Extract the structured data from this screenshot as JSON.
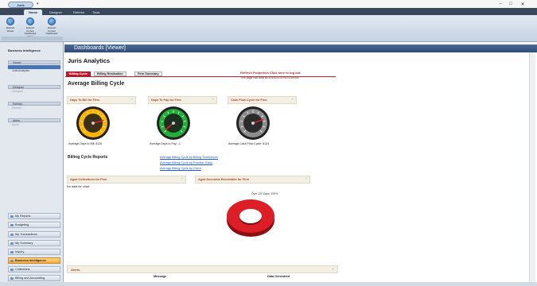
{
  "titlebar": {
    "orb_label": "Juris",
    "window_controls": [
      "–",
      "□",
      "✕"
    ]
  },
  "ribbon": {
    "tabs": [
      "Home",
      "Designer",
      "Refresh",
      "Tools"
    ],
    "buttons": [
      {
        "label": "Refresh Viewer",
        "icon": "refresh-icon"
      },
      {
        "label": "Refresh Current Dashboard Page",
        "icon": "refresh-icon"
      },
      {
        "label": "Refresh Current Dashboard",
        "icon": "refresh-icon"
      }
    ]
  },
  "sidebar": {
    "header": "Business Intelligence",
    "sections": [
      {
        "label": "Viewer",
        "sub": "Juris Analytics",
        "selected": true
      },
      {
        "label": "Designer",
        "sub": "Designer"
      },
      {
        "label": "Refresh",
        "sub": "Refresh"
      },
      {
        "label": "Alerts",
        "sub": "Alerts"
      }
    ],
    "nav": [
      "My Reports",
      "Budgeting",
      "My Transactions",
      "My Summary",
      "Inquiry",
      "Business Intelligence",
      "Collections",
      "Billing and Accounting"
    ],
    "active_nav": "Business Intelligence"
  },
  "content": {
    "header": "Dashboards [Viewer]",
    "page_title": "Juris Analytics",
    "tabs": [
      "Billing Cycle",
      "Billing Realization",
      "Firm Summary"
    ],
    "links": "Refresh  Properties  Click here to log out.",
    "refresh_note": "This page has data as of 8/5/2018 08:03:58 AM",
    "section_title": "Average Billing Cycle",
    "gauges": [
      {
        "title": "Days To Bill for Firm",
        "caption": "Average Days to Bill: 8126",
        "value": 0.78,
        "face": "#ffb400"
      },
      {
        "title": "Days To Pay for Firm",
        "caption": "Average Days to Pay: -1",
        "value": 0.02,
        "face": "#22b03a"
      },
      {
        "title": "Cash Flow Cycle for Firm",
        "caption": "Average Cash Flow Cycle: 8124",
        "value": 0.76,
        "face": "#8d8d8d"
      }
    ],
    "reports_title": "Billing Cycle Reports",
    "report_links": [
      "Average Billing Cycle by Billing Timekeeper",
      "Average Billing Cycle by Practice Class",
      "Average Billing Cycle by Client"
    ],
    "aged_collections_title": "Aged Collections for Firm",
    "no_data": "No data for chart.",
    "aged_ar_title": "Aged Accounts Receivable for Firm",
    "donut_label": "Over 120 Days: 100%",
    "alerts": {
      "title": "Alerts",
      "columns": [
        "Message",
        "Data Generated"
      ]
    }
  }
}
